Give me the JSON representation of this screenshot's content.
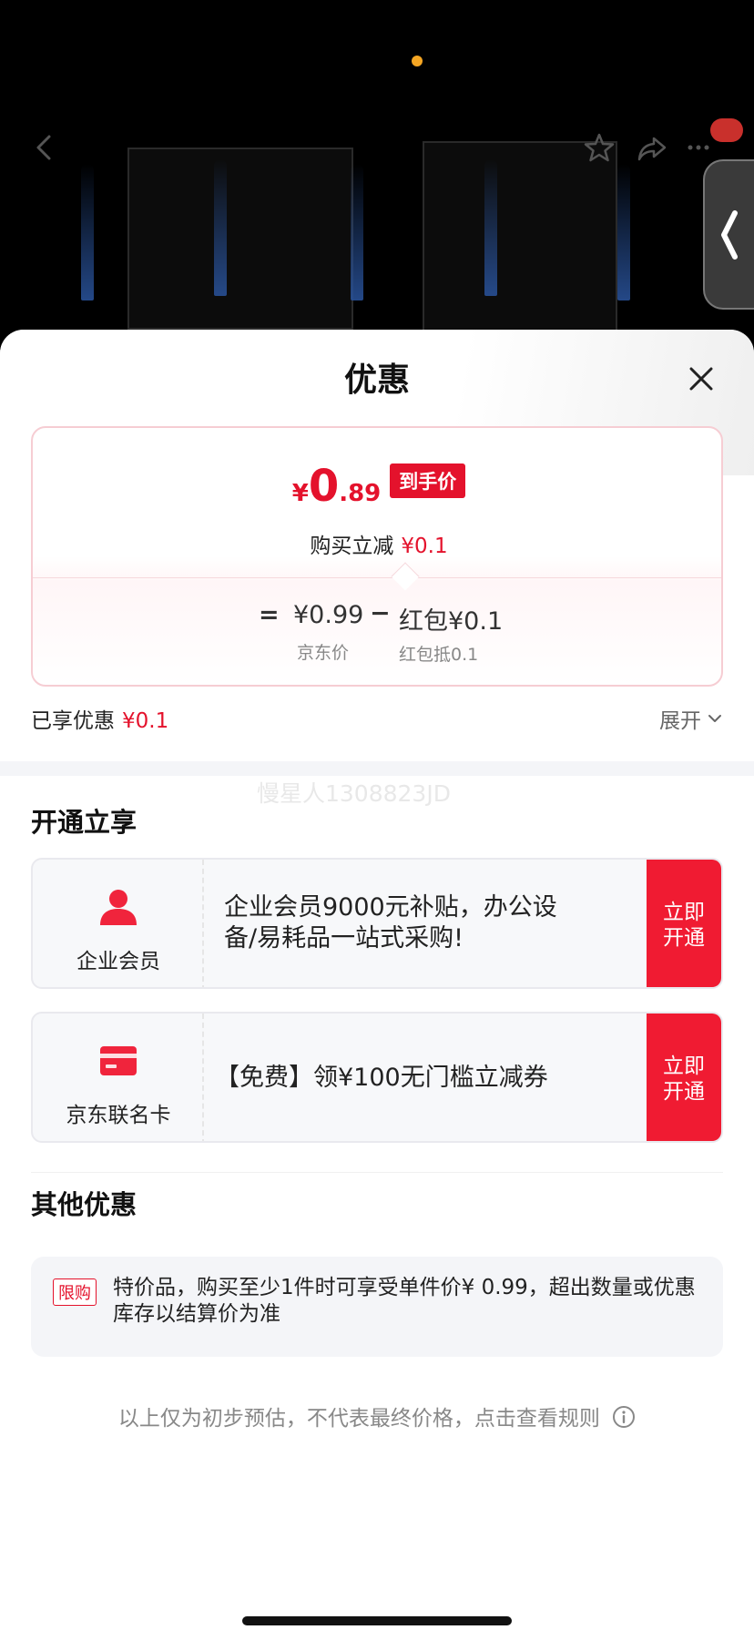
{
  "sheet": {
    "title": "优惠",
    "price": {
      "yen": "¥",
      "integer": "0",
      "decimal": ".89",
      "tag": "到手价",
      "reduce_label": "购买立减",
      "reduce_value": "¥0.1"
    },
    "formula": {
      "equals": "=",
      "jd_price": "¥0.99",
      "minus": "−",
      "redpacket": "红包¥0.1",
      "jd_price_label": "京东价",
      "redpacket_label": "红包抵0.1"
    },
    "enjoyed_label": "已享优惠",
    "enjoyed_value": "¥0.1",
    "expand_label": "展开",
    "watermark": "慢星人1308823JD"
  },
  "open_section": {
    "title": "开通立享",
    "cards": [
      {
        "label": "企业会员",
        "desc": "企业会员9000元补贴，办公设备/易耗品一站式采购!",
        "button": "立即开通"
      },
      {
        "label": "京东联名卡",
        "desc": "【免费】领¥100无门槛立减券",
        "button": "立即开通"
      }
    ]
  },
  "other_section": {
    "title": "其他优惠",
    "tag": "限购",
    "text": "特价品，购买至少1件时可享受单件价¥ 0.99，超出数量或优惠库存以结算价为准"
  },
  "disclaimer": "以上仅为初步预估，不代表最终价格，点击查看规则",
  "colors": {
    "accent": "#e4122c",
    "button_red": "#f01b32",
    "indicator_dot": "#f5a623"
  }
}
